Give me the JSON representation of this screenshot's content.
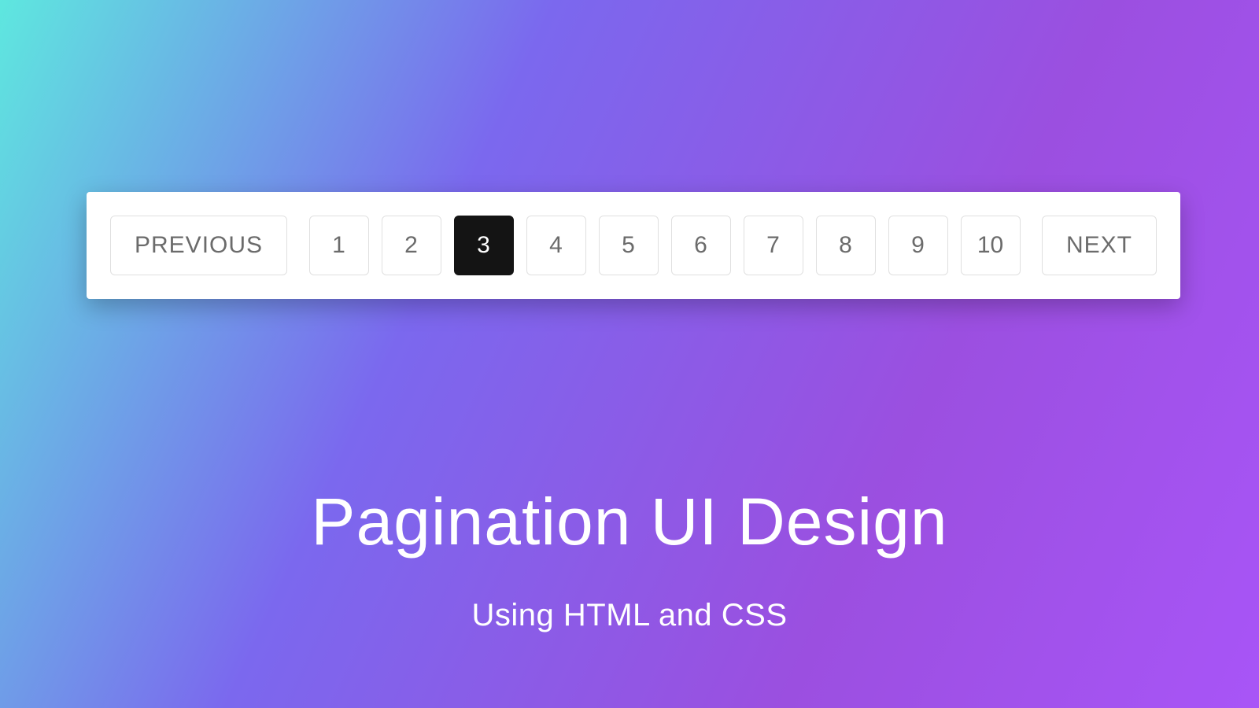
{
  "pagination": {
    "previous_label": "PREVIOUS",
    "next_label": "NEXT",
    "pages": [
      "1",
      "2",
      "3",
      "4",
      "5",
      "6",
      "7",
      "8",
      "9",
      "10"
    ],
    "active_page": "3"
  },
  "headline": {
    "title": "Pagination UI Design",
    "subtitle": "Using HTML and CSS"
  }
}
